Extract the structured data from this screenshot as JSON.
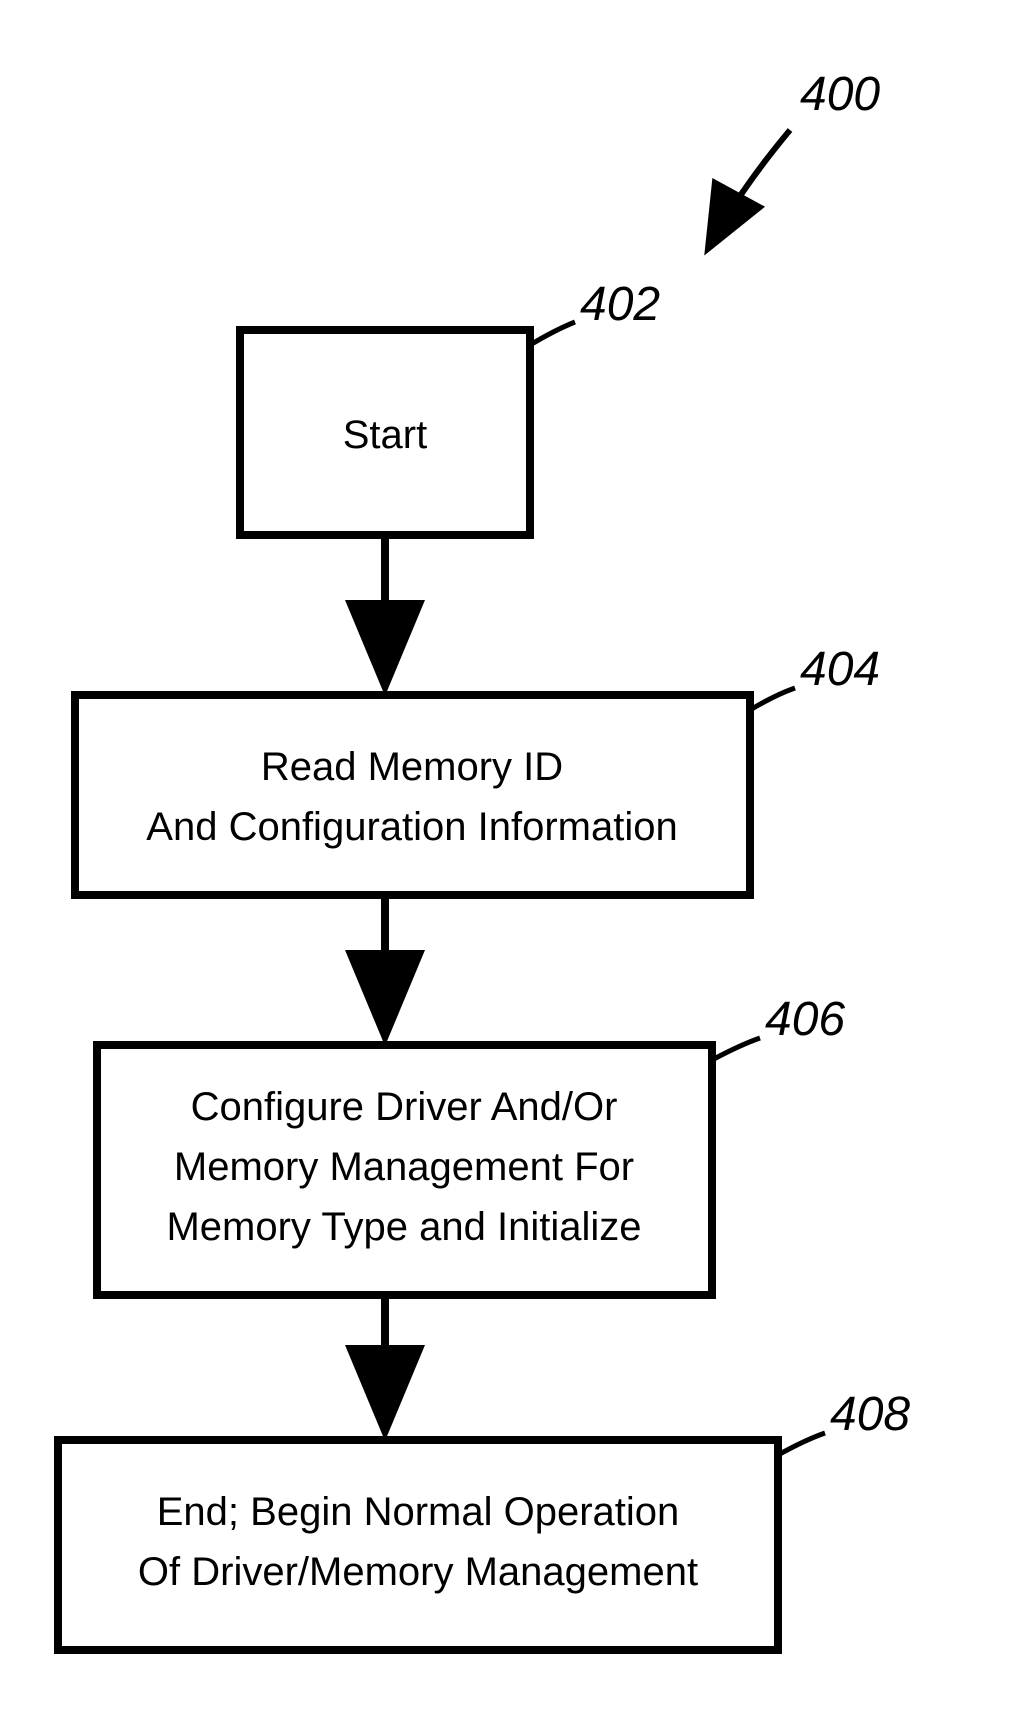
{
  "diagram": {
    "title_label": "400",
    "nodes": {
      "start": {
        "label": "402",
        "text": "Start"
      },
      "read": {
        "label": "404",
        "line1": "Read Memory ID",
        "line2": "And Configuration Information"
      },
      "config": {
        "label": "406",
        "line1": "Configure Driver And/Or",
        "line2": "Memory Management For",
        "line3": "Memory Type and Initialize"
      },
      "end": {
        "label": "408",
        "line1": "End; Begin Normal Operation",
        "line2": "Of Driver/Memory Management"
      }
    }
  }
}
